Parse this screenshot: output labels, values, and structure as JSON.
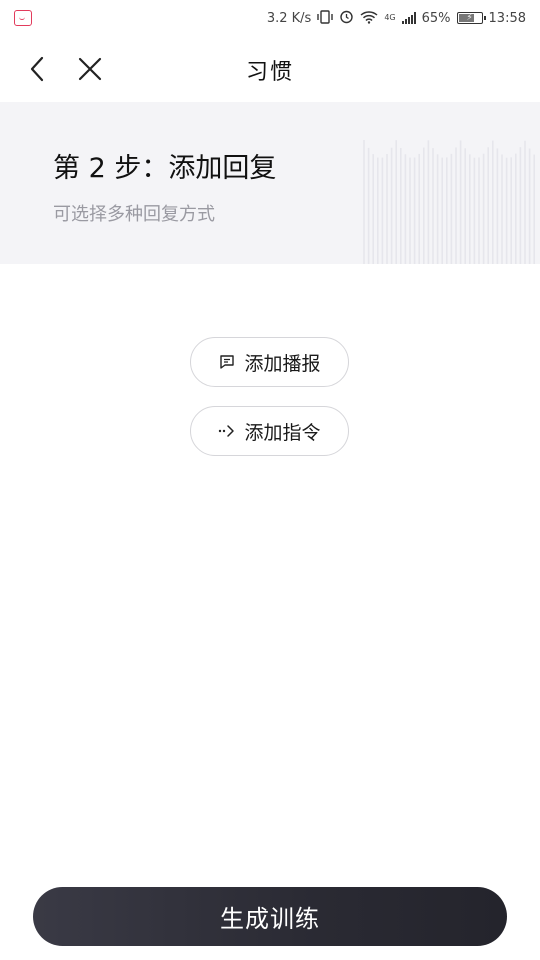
{
  "status_bar": {
    "net_speed": "3.2 K/s",
    "network": "4G",
    "battery": "65%",
    "time": "13:58"
  },
  "nav": {
    "title": "习惯"
  },
  "step": {
    "title": "第 2 步：添加回复",
    "subtitle": "可选择多种回复方式"
  },
  "actions": {
    "add_broadcast": "添加播报",
    "add_command": "添加指令"
  },
  "footer": {
    "generate_label": "生成训练"
  },
  "colors": {
    "panel_bg": "#f4f4f7",
    "primary_btn": "#2a2a33",
    "subtitle": "#9a9aa2"
  }
}
